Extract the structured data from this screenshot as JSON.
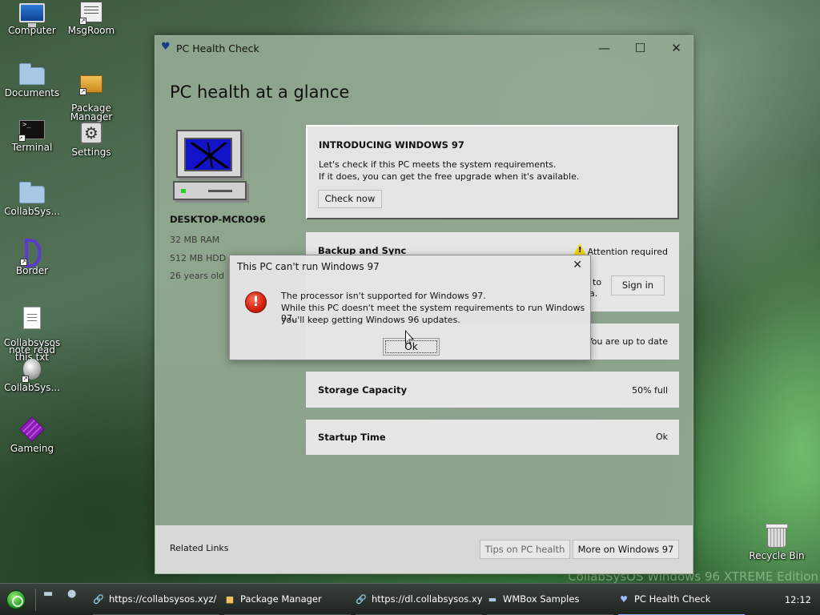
{
  "desktop": {
    "icons": [
      {
        "label": "Computer"
      },
      {
        "label": "MsgRoom"
      },
      {
        "label": "Documents"
      },
      {
        "label": "Package\nManager"
      },
      {
        "label": "Terminal"
      },
      {
        "label": "Settings"
      },
      {
        "label": "CollabSys..."
      },
      {
        "label": "Border"
      },
      {
        "label": "Collabsysos\nnote read\nthis.txt"
      },
      {
        "label": "CollabSys..."
      },
      {
        "label": "Gameing"
      },
      {
        "label": "Recycle Bin"
      }
    ],
    "watermark": "CollabSysOS Windows 96 XTREME Edition"
  },
  "window": {
    "title": "PC Health Check",
    "heading": "PC health at a glance",
    "device_name": "DESKTOP-MCRO96",
    "specs": [
      "32 MB RAM",
      "512 MB HDD",
      "26 years old"
    ],
    "intro": {
      "title": "INTRODUCING WINDOWS 97",
      "line1": "Let's check if this PC meets the system requirements.",
      "line2": "If it does, you can get the free upgrade when it's available.",
      "button": "Check now"
    },
    "backup": {
      "name": "Backup and Sync",
      "status": "Attention required",
      "partial_text": "to",
      "partial_text2": "a.",
      "button": "Sign in"
    },
    "update": {
      "status": "You are up to date"
    },
    "storage": {
      "name": "Storage Capacity",
      "status": "50% full"
    },
    "startup": {
      "name": "Startup Time",
      "status": "Ok"
    },
    "footer": {
      "related_links": "Related Links",
      "tips_button": "Tips on PC health",
      "more_button": "More on Windows 97"
    }
  },
  "dialog": {
    "title": "This PC can't run Windows 97",
    "line1": "The processor isn't supported for Windows 97.",
    "line2": "While this PC doesn't meet the system requirements to run Windows 97,",
    "line3": "you'll keep getting Windows 96 updates.",
    "ok": "Ok"
  },
  "taskbar": {
    "tasks": [
      {
        "label": "https://collabsysos.xyz/ ...",
        "icon": "shortcut-icon"
      },
      {
        "label": "Package Manager",
        "icon": "package-icon"
      },
      {
        "label": "https://dl.collabsysos.xy...",
        "icon": "shortcut-icon"
      },
      {
        "label": "WMBox Samples",
        "icon": "folder-icon"
      },
      {
        "label": "PC Health Check",
        "icon": "heart-monitor-icon"
      }
    ],
    "clock": "12:12"
  },
  "colors": {
    "error": "#d11e0c",
    "warning": "#f5d90a",
    "accent_green": "#2a9c2a"
  }
}
